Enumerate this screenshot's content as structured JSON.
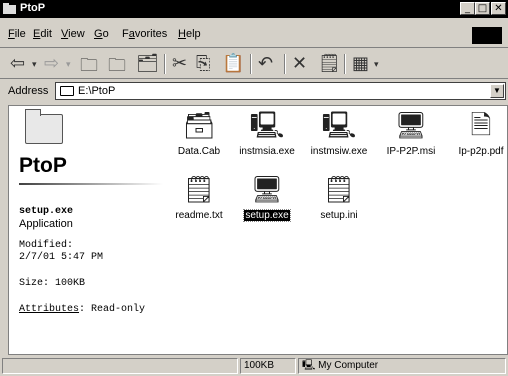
{
  "window": {
    "title": "PtoP"
  },
  "menu": [
    {
      "label": "File",
      "key": "F",
      "rest": "ile"
    },
    {
      "label": "Edit",
      "key": "E",
      "rest": "dit"
    },
    {
      "label": "View",
      "key": "V",
      "rest": "iew"
    },
    {
      "label": "Go",
      "key": "G",
      "rest": "o"
    },
    {
      "label": "Favorites",
      "pre": "F",
      "key": "a",
      "rest": "vorites"
    },
    {
      "label": "Help",
      "key": "H",
      "rest": "elp"
    }
  ],
  "address": {
    "label": "Address",
    "value": "E:\\PtoP"
  },
  "folder": {
    "title": "PtoP",
    "selected_name": "setup.exe",
    "selected_type": "Application",
    "modified_label": "Modified:",
    "modified_value": "2/7/01 5:47 PM",
    "size_text": "Size: 100KB",
    "attributes_label": "Attributes",
    "attributes_value": ": Read-only"
  },
  "files": [
    {
      "name": "Data.Cab",
      "icon": "cabinet-icon"
    },
    {
      "name": "instmsia.exe",
      "icon": "application-icon"
    },
    {
      "name": "instmsiw.exe",
      "icon": "application-icon"
    },
    {
      "name": "IP-P2P.msi",
      "icon": "installer-package-icon"
    },
    {
      "name": "Ip-p2p.pdf",
      "icon": "pdf-document-icon"
    },
    {
      "name": "readme.txt",
      "icon": "text-file-icon"
    },
    {
      "name": "setup.exe",
      "icon": "setup-program-icon",
      "selected": true
    },
    {
      "name": "setup.ini",
      "icon": "config-file-icon"
    }
  ],
  "status": {
    "size": "100KB",
    "zone": "My Computer"
  }
}
